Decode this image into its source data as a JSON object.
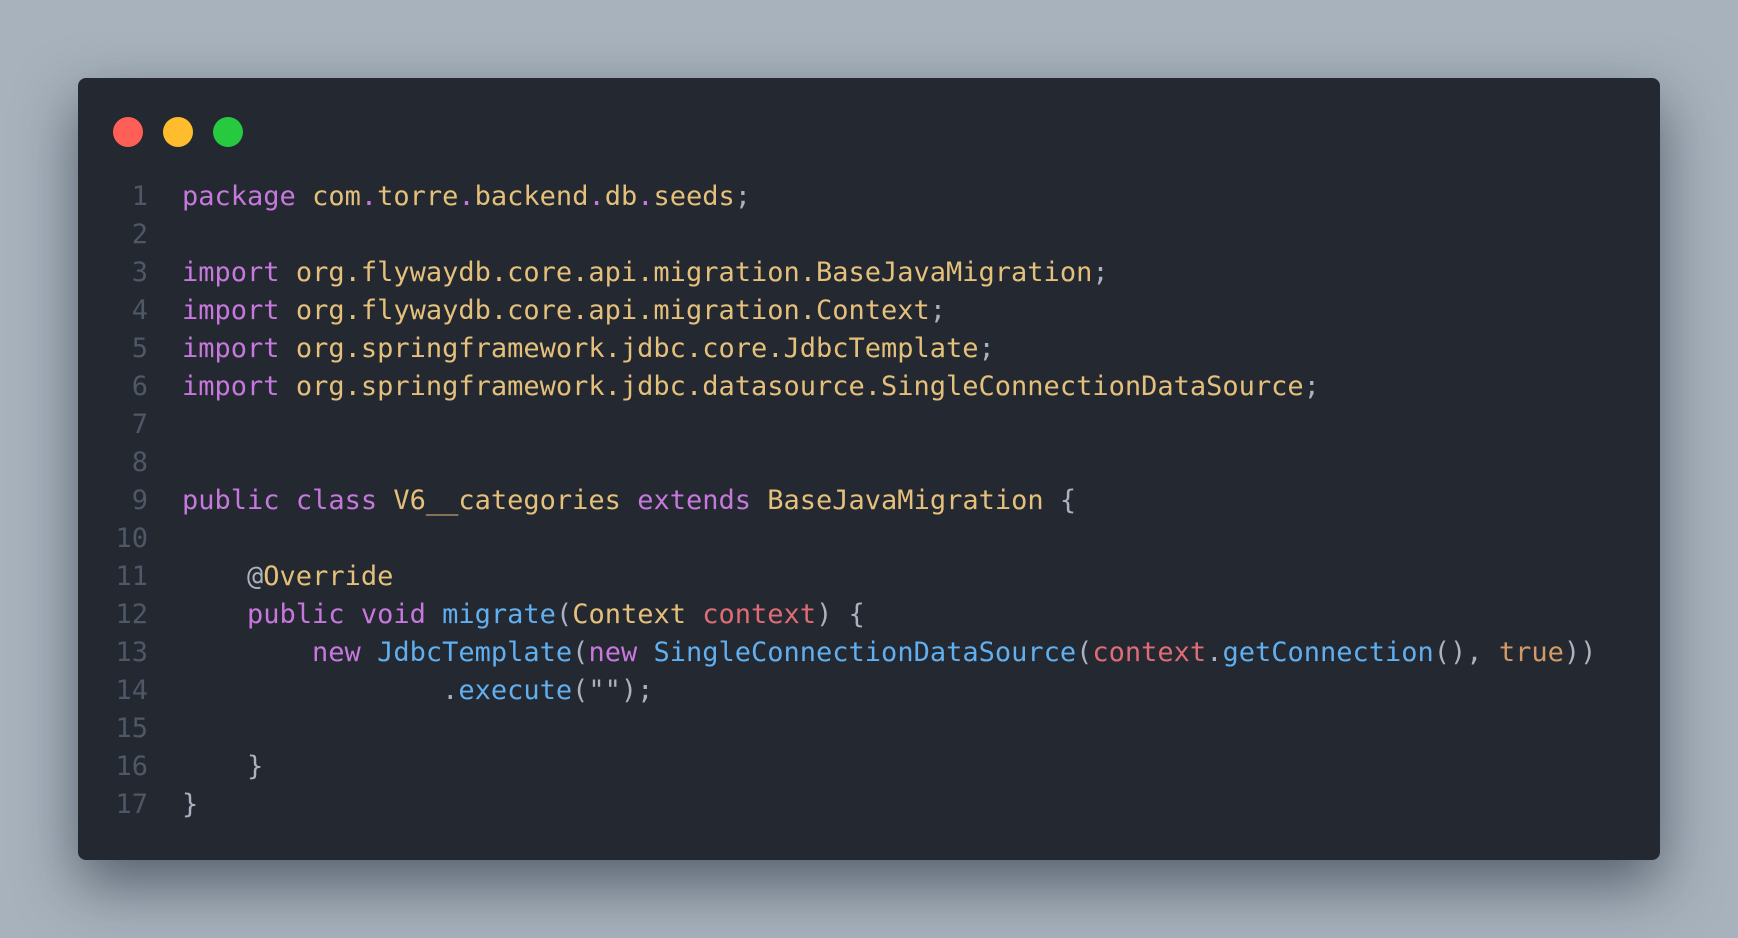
{
  "window": {
    "controls": [
      {
        "name": "close",
        "color": "#ff5f56"
      },
      {
        "name": "minimize",
        "color": "#ffbd2e"
      },
      {
        "name": "zoom",
        "color": "#27c93f"
      }
    ]
  },
  "colors": {
    "keyword": "#c678dd",
    "type": "#e5c07b",
    "function": "#61afef",
    "variable": "#e06c75",
    "literal": "#d19a66",
    "plain": "#abb2bf",
    "line_number": "#4f5866",
    "background": "#232831",
    "page_background": "#a7b2bd"
  },
  "code": {
    "language": "java",
    "lines": [
      {
        "number": "1",
        "tokens": [
          {
            "t": "package",
            "c": "keyword"
          },
          {
            "t": " ",
            "c": "plain"
          },
          {
            "t": "com",
            "c": "type"
          },
          {
            "t": ".",
            "c": "keyword"
          },
          {
            "t": "torre",
            "c": "type"
          },
          {
            "t": ".",
            "c": "keyword"
          },
          {
            "t": "backend",
            "c": "type"
          },
          {
            "t": ".",
            "c": "keyword"
          },
          {
            "t": "db",
            "c": "type"
          },
          {
            "t": ".",
            "c": "keyword"
          },
          {
            "t": "seeds",
            "c": "type"
          },
          {
            "t": ";",
            "c": "plain"
          }
        ]
      },
      {
        "number": "2",
        "tokens": []
      },
      {
        "number": "3",
        "tokens": [
          {
            "t": "import",
            "c": "keyword"
          },
          {
            "t": " ",
            "c": "plain"
          },
          {
            "t": "org.flywaydb.core.api.migration.BaseJavaMigration",
            "c": "type"
          },
          {
            "t": ";",
            "c": "plain"
          }
        ]
      },
      {
        "number": "4",
        "tokens": [
          {
            "t": "import",
            "c": "keyword"
          },
          {
            "t": " ",
            "c": "plain"
          },
          {
            "t": "org.flywaydb.core.api.migration.Context",
            "c": "type"
          },
          {
            "t": ";",
            "c": "plain"
          }
        ]
      },
      {
        "number": "5",
        "tokens": [
          {
            "t": "import",
            "c": "keyword"
          },
          {
            "t": " ",
            "c": "plain"
          },
          {
            "t": "org.springframework.jdbc.core.JdbcTemplate",
            "c": "type"
          },
          {
            "t": ";",
            "c": "plain"
          }
        ]
      },
      {
        "number": "6",
        "tokens": [
          {
            "t": "import",
            "c": "keyword"
          },
          {
            "t": " ",
            "c": "plain"
          },
          {
            "t": "org.springframework.jdbc.datasource.SingleConnectionDataSource",
            "c": "type"
          },
          {
            "t": ";",
            "c": "plain"
          }
        ]
      },
      {
        "number": "7",
        "tokens": []
      },
      {
        "number": "8",
        "tokens": []
      },
      {
        "number": "9",
        "tokens": [
          {
            "t": "public",
            "c": "keyword"
          },
          {
            "t": " ",
            "c": "plain"
          },
          {
            "t": "class",
            "c": "keyword"
          },
          {
            "t": " ",
            "c": "plain"
          },
          {
            "t": "V6__categories",
            "c": "type"
          },
          {
            "t": " ",
            "c": "plain"
          },
          {
            "t": "extends",
            "c": "keyword"
          },
          {
            "t": " ",
            "c": "plain"
          },
          {
            "t": "BaseJavaMigration",
            "c": "type"
          },
          {
            "t": " {",
            "c": "plain"
          }
        ]
      },
      {
        "number": "10",
        "tokens": []
      },
      {
        "number": "11",
        "tokens": [
          {
            "t": "    ",
            "c": "plain"
          },
          {
            "t": "@",
            "c": "plain"
          },
          {
            "t": "Override",
            "c": "type"
          }
        ]
      },
      {
        "number": "12",
        "tokens": [
          {
            "t": "    ",
            "c": "plain"
          },
          {
            "t": "public",
            "c": "keyword"
          },
          {
            "t": " ",
            "c": "plain"
          },
          {
            "t": "void",
            "c": "keyword"
          },
          {
            "t": " ",
            "c": "plain"
          },
          {
            "t": "migrate",
            "c": "function"
          },
          {
            "t": "(",
            "c": "plain"
          },
          {
            "t": "Context",
            "c": "type"
          },
          {
            "t": " ",
            "c": "plain"
          },
          {
            "t": "context",
            "c": "variable"
          },
          {
            "t": ") {",
            "c": "plain"
          }
        ]
      },
      {
        "number": "13",
        "tokens": [
          {
            "t": "        ",
            "c": "plain"
          },
          {
            "t": "new",
            "c": "keyword"
          },
          {
            "t": " ",
            "c": "plain"
          },
          {
            "t": "JdbcTemplate",
            "c": "function"
          },
          {
            "t": "(",
            "c": "plain"
          },
          {
            "t": "new",
            "c": "keyword"
          },
          {
            "t": " ",
            "c": "plain"
          },
          {
            "t": "SingleConnectionDataSource",
            "c": "function"
          },
          {
            "t": "(",
            "c": "plain"
          },
          {
            "t": "context",
            "c": "variable"
          },
          {
            "t": ".",
            "c": "plain"
          },
          {
            "t": "getConnection",
            "c": "function"
          },
          {
            "t": "(), ",
            "c": "plain"
          },
          {
            "t": "true",
            "c": "literal"
          },
          {
            "t": "))",
            "c": "plain"
          }
        ]
      },
      {
        "number": "14",
        "tokens": [
          {
            "t": "                ",
            "c": "plain"
          },
          {
            "t": ".",
            "c": "plain"
          },
          {
            "t": "execute",
            "c": "function"
          },
          {
            "t": "(\"\");",
            "c": "plain"
          }
        ]
      },
      {
        "number": "15",
        "tokens": []
      },
      {
        "number": "16",
        "tokens": [
          {
            "t": "    ",
            "c": "plain"
          },
          {
            "t": "}",
            "c": "plain"
          }
        ]
      },
      {
        "number": "17",
        "tokens": [
          {
            "t": "}",
            "c": "plain"
          }
        ]
      }
    ]
  }
}
